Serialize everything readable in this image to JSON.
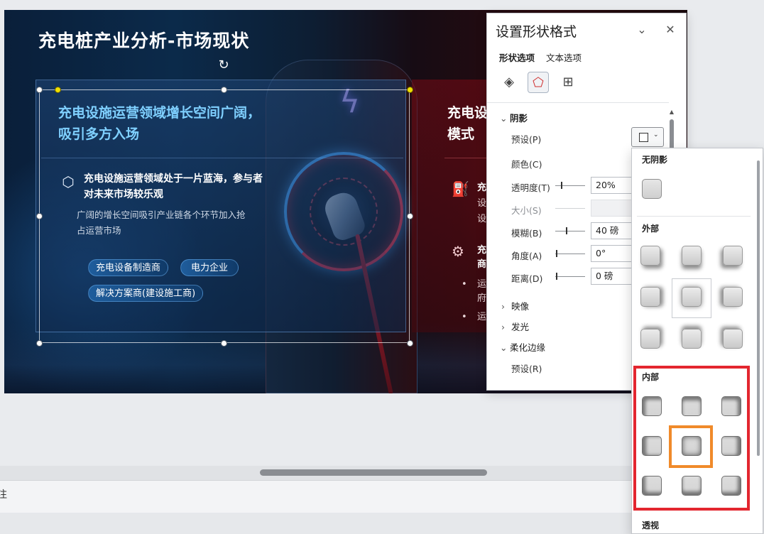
{
  "slide": {
    "title": "充电桩产业分析-市场现状",
    "left_panel": {
      "title": "充电设施运营领域增长空间广阔，吸引多方入场",
      "icon": "cube-network-icon",
      "headline": "充电设施运营领域处于一片蓝海，参与者对未来市场较乐观",
      "body": "广阔的增长空间吸引产业链各个环节加入抢占运营市场",
      "tags": [
        "充电设备制造商",
        "电力企业",
        "解决方案商(建设施工商)"
      ]
    },
    "right_panel": {
      "title_line1": "充电设",
      "title_line2": "模式",
      "item1_head": "充",
      "item1_lines": [
        "设",
        "设"
      ],
      "item2_head_line1": "充",
      "item2_head_line2": "商",
      "bullets": [
        "运",
        "府",
        "运"
      ]
    }
  },
  "notes": {
    "label": "注"
  },
  "pane": {
    "title": "设置形状格式",
    "tabs": [
      "形状选项",
      "文本选项"
    ],
    "categories": [
      "fill-bucket-icon",
      "pentagon-effects-icon",
      "size-layout-icon"
    ],
    "shadow": {
      "header": "阴影",
      "preset_label": "预设(P)",
      "color_label": "颜色(C)",
      "transparency_label": "透明度(T)",
      "transparency_value": "20%",
      "size_label": "大小(S)",
      "size_value": "",
      "blur_label": "模糊(B)",
      "blur_value": "40 磅",
      "angle_label": "角度(A)",
      "angle_value": "0°",
      "distance_label": "距离(D)",
      "distance_value": "0 磅"
    },
    "sections": {
      "reflection": "映像",
      "glow": "发光",
      "soft_edges": "柔化边缘",
      "soft_preset_label": "预设(R)"
    }
  },
  "gallery": {
    "no_shadow": "无阴影",
    "outer": "外部",
    "inner": "内部",
    "perspective": "透视",
    "selected_inner_index": 4
  }
}
